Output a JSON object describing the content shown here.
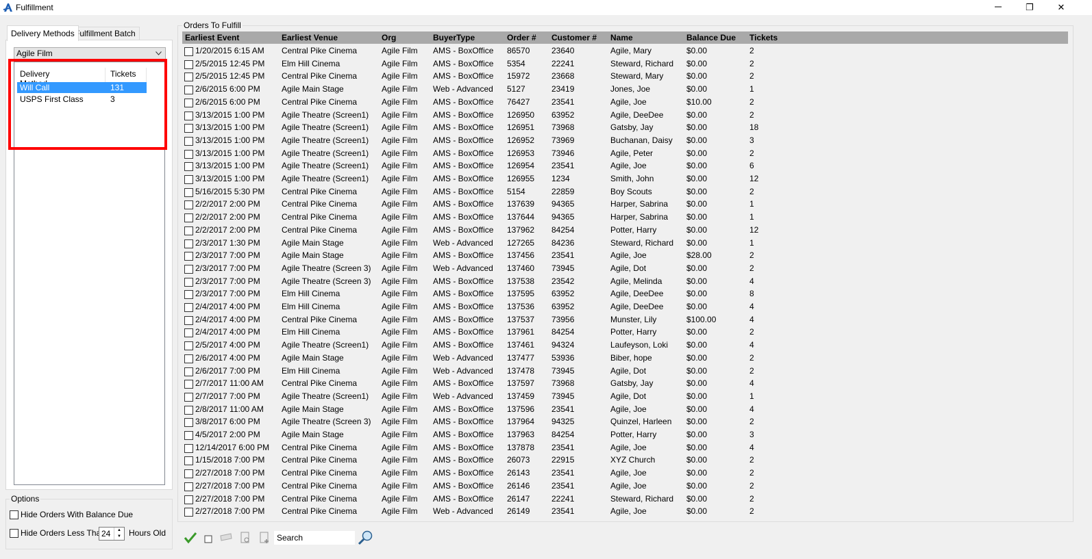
{
  "window": {
    "title": "Fulfillment",
    "restore_glyph": "❐",
    "close_glyph": "✕"
  },
  "tabs": [
    {
      "label": "Delivery Methods"
    },
    {
      "label": "Fulfillment Batch"
    }
  ],
  "org_select": {
    "value": "Agile Film"
  },
  "delivery_list": {
    "columns": {
      "method": "Delivery Method",
      "tickets": "Tickets"
    },
    "rows": [
      {
        "method": "Will Call",
        "tickets": "131"
      },
      {
        "method": "USPS First Class",
        "tickets": "3"
      }
    ]
  },
  "options": {
    "title": "Options",
    "hide_balance_label": "Hide Orders With Balance Due",
    "hide_less_than_label": "Hide Orders Less Than",
    "hours_value": "24",
    "hours_suffix": "Hours Old"
  },
  "orders": {
    "group_title": "Orders To Fulfill",
    "columns": {
      "event": "Earliest Event",
      "venue": "Earliest Venue",
      "org": "Org",
      "buyer": "BuyerType",
      "order": "Order #",
      "customer": "Customer #",
      "name": "Name",
      "balance": "Balance Due",
      "tickets": "Tickets"
    },
    "rows": [
      {
        "event": "1/20/2015 6:15 AM",
        "venue": "Central Pike Cinema",
        "org": "Agile Film",
        "buyer": "AMS - BoxOffice",
        "order": "86570",
        "customer": "23640",
        "name": "Agile, Mary",
        "balance": "$0.00",
        "tickets": "2"
      },
      {
        "event": "2/5/2015 12:45 PM",
        "venue": "Elm Hill Cinema",
        "org": "Agile Film",
        "buyer": "AMS - BoxOffice",
        "order": "5354",
        "customer": "22241",
        "name": "Steward, Richard",
        "balance": "$0.00",
        "tickets": "2"
      },
      {
        "event": "2/5/2015 12:45 PM",
        "venue": "Central Pike Cinema",
        "org": "Agile Film",
        "buyer": "AMS - BoxOffice",
        "order": "15972",
        "customer": "23668",
        "name": "Steward, Mary",
        "balance": "$0.00",
        "tickets": "2"
      },
      {
        "event": "2/6/2015 6:00 PM",
        "venue": "Agile Main Stage",
        "org": "Agile Film",
        "buyer": "Web - Advanced",
        "order": "5127",
        "customer": "23419",
        "name": "Jones, Joe",
        "balance": "$0.00",
        "tickets": "1"
      },
      {
        "event": "2/6/2015 6:00 PM",
        "venue": "Central Pike Cinema",
        "org": "Agile Film",
        "buyer": "AMS - BoxOffice",
        "order": "76427",
        "customer": "23541",
        "name": "Agile, Joe",
        "balance": "$10.00",
        "tickets": "2"
      },
      {
        "event": "3/13/2015 1:00 PM",
        "venue": "Agile Theatre (Screen1)",
        "org": "Agile Film",
        "buyer": "AMS - BoxOffice",
        "order": "126950",
        "customer": "63952",
        "name": "Agile, DeeDee",
        "balance": "$0.00",
        "tickets": "2"
      },
      {
        "event": "3/13/2015 1:00 PM",
        "venue": "Agile Theatre (Screen1)",
        "org": "Agile Film",
        "buyer": "AMS - BoxOffice",
        "order": "126951",
        "customer": "73968",
        "name": "Gatsby, Jay",
        "balance": "$0.00",
        "tickets": "18"
      },
      {
        "event": "3/13/2015 1:00 PM",
        "venue": "Agile Theatre (Screen1)",
        "org": "Agile Film",
        "buyer": "AMS - BoxOffice",
        "order": "126952",
        "customer": "73969",
        "name": "Buchanan, Daisy",
        "balance": "$0.00",
        "tickets": "3"
      },
      {
        "event": "3/13/2015 1:00 PM",
        "venue": "Agile Theatre (Screen1)",
        "org": "Agile Film",
        "buyer": "AMS - BoxOffice",
        "order": "126953",
        "customer": "73946",
        "name": "Agile, Peter",
        "balance": "$0.00",
        "tickets": "2"
      },
      {
        "event": "3/13/2015 1:00 PM",
        "venue": "Agile Theatre (Screen1)",
        "org": "Agile Film",
        "buyer": "AMS - BoxOffice",
        "order": "126954",
        "customer": "23541",
        "name": "Agile, Joe",
        "balance": "$0.00",
        "tickets": "6"
      },
      {
        "event": "3/13/2015 1:00 PM",
        "venue": "Agile Theatre (Screen1)",
        "org": "Agile Film",
        "buyer": "AMS - BoxOffice",
        "order": "126955",
        "customer": "1234",
        "name": "Smith, John",
        "balance": "$0.00",
        "tickets": "12"
      },
      {
        "event": "5/16/2015 5:30 PM",
        "venue": "Central Pike Cinema",
        "org": "Agile Film",
        "buyer": "AMS - BoxOffice",
        "order": "5154",
        "customer": "22859",
        "name": "Boy Scouts",
        "balance": "$0.00",
        "tickets": "2"
      },
      {
        "event": "2/2/2017 2:00 PM",
        "venue": "Central Pike Cinema",
        "org": "Agile Film",
        "buyer": "AMS - BoxOffice",
        "order": "137639",
        "customer": "94365",
        "name": "Harper, Sabrina",
        "balance": "$0.00",
        "tickets": "1"
      },
      {
        "event": "2/2/2017 2:00 PM",
        "venue": "Central Pike Cinema",
        "org": "Agile Film",
        "buyer": "AMS - BoxOffice",
        "order": "137644",
        "customer": "94365",
        "name": "Harper, Sabrina",
        "balance": "$0.00",
        "tickets": "1"
      },
      {
        "event": "2/2/2017 2:00 PM",
        "venue": "Central Pike Cinema",
        "org": "Agile Film",
        "buyer": "AMS - BoxOffice",
        "order": "137962",
        "customer": "84254",
        "name": "Potter, Harry",
        "balance": "$0.00",
        "tickets": "12"
      },
      {
        "event": "2/3/2017 1:30 PM",
        "venue": "Agile Main Stage",
        "org": "Agile Film",
        "buyer": "Web - Advanced",
        "order": "127265",
        "customer": "84236",
        "name": "Steward, Richard",
        "balance": "$0.00",
        "tickets": "1"
      },
      {
        "event": "2/3/2017 7:00 PM",
        "venue": "Agile Main Stage",
        "org": "Agile Film",
        "buyer": "AMS - BoxOffice",
        "order": "137456",
        "customer": "23541",
        "name": "Agile, Joe",
        "balance": "$28.00",
        "tickets": "2"
      },
      {
        "event": "2/3/2017 7:00 PM",
        "venue": "Agile Theatre (Screen 3)",
        "org": "Agile Film",
        "buyer": "Web - Advanced",
        "order": "137460",
        "customer": "73945",
        "name": "Agile, Dot",
        "balance": "$0.00",
        "tickets": "2"
      },
      {
        "event": "2/3/2017 7:00 PM",
        "venue": "Agile Theatre (Screen 3)",
        "org": "Agile Film",
        "buyer": "AMS - BoxOffice",
        "order": "137538",
        "customer": "23542",
        "name": "Agile, Melinda",
        "balance": "$0.00",
        "tickets": "4"
      },
      {
        "event": "2/3/2017 7:00 PM",
        "venue": "Elm Hill Cinema",
        "org": "Agile Film",
        "buyer": "AMS - BoxOffice",
        "order": "137595",
        "customer": "63952",
        "name": "Agile, DeeDee",
        "balance": "$0.00",
        "tickets": "8"
      },
      {
        "event": "2/4/2017 4:00 PM",
        "venue": "Elm Hill Cinema",
        "org": "Agile Film",
        "buyer": "AMS - BoxOffice",
        "order": "137536",
        "customer": "63952",
        "name": "Agile, DeeDee",
        "balance": "$0.00",
        "tickets": "4"
      },
      {
        "event": "2/4/2017 4:00 PM",
        "venue": "Central Pike Cinema",
        "org": "Agile Film",
        "buyer": "AMS - BoxOffice",
        "order": "137537",
        "customer": "73956",
        "name": "Munster, Lily",
        "balance": "$100.00",
        "tickets": "4"
      },
      {
        "event": "2/4/2017 4:00 PM",
        "venue": "Elm Hill Cinema",
        "org": "Agile Film",
        "buyer": "AMS - BoxOffice",
        "order": "137961",
        "customer": "84254",
        "name": "Potter, Harry",
        "balance": "$0.00",
        "tickets": "2"
      },
      {
        "event": "2/5/2017 4:00 PM",
        "venue": "Agile Theatre (Screen1)",
        "org": "Agile Film",
        "buyer": "AMS - BoxOffice",
        "order": "137461",
        "customer": "94324",
        "name": "Laufeyson, Loki",
        "balance": "$0.00",
        "tickets": "4"
      },
      {
        "event": "2/6/2017 4:00 PM",
        "venue": "Agile Main Stage",
        "org": "Agile Film",
        "buyer": "Web - Advanced",
        "order": "137477",
        "customer": "53936",
        "name": "Biber, hope",
        "balance": "$0.00",
        "tickets": "2"
      },
      {
        "event": "2/6/2017 7:00 PM",
        "venue": "Elm Hill Cinema",
        "org": "Agile Film",
        "buyer": "Web - Advanced",
        "order": "137478",
        "customer": "73945",
        "name": "Agile, Dot",
        "balance": "$0.00",
        "tickets": "2"
      },
      {
        "event": "2/7/2017 11:00 AM",
        "venue": "Central Pike Cinema",
        "org": "Agile Film",
        "buyer": "AMS - BoxOffice",
        "order": "137597",
        "customer": "73968",
        "name": "Gatsby, Jay",
        "balance": "$0.00",
        "tickets": "4"
      },
      {
        "event": "2/7/2017 7:00 PM",
        "venue": "Agile Theatre (Screen1)",
        "org": "Agile Film",
        "buyer": "Web - Advanced",
        "order": "137459",
        "customer": "73945",
        "name": "Agile, Dot",
        "balance": "$0.00",
        "tickets": "1"
      },
      {
        "event": "2/8/2017 11:00 AM",
        "venue": "Agile Main Stage",
        "org": "Agile Film",
        "buyer": "AMS - BoxOffice",
        "order": "137596",
        "customer": "23541",
        "name": "Agile, Joe",
        "balance": "$0.00",
        "tickets": "4"
      },
      {
        "event": "3/8/2017 6:00 PM",
        "venue": "Agile Theatre (Screen 3)",
        "org": "Agile Film",
        "buyer": "AMS - BoxOffice",
        "order": "137964",
        "customer": "94325",
        "name": "Quinzel, Harleen",
        "balance": "$0.00",
        "tickets": "2"
      },
      {
        "event": "4/5/2017 2:00 PM",
        "venue": "Agile Main Stage",
        "org": "Agile Film",
        "buyer": "AMS - BoxOffice",
        "order": "137963",
        "customer": "84254",
        "name": "Potter, Harry",
        "balance": "$0.00",
        "tickets": "3"
      },
      {
        "event": "12/14/2017 6:00 PM",
        "venue": "Central Pike Cinema",
        "org": "Agile Film",
        "buyer": "AMS - BoxOffice",
        "order": "137878",
        "customer": "23541",
        "name": "Agile, Joe",
        "balance": "$0.00",
        "tickets": "4"
      },
      {
        "event": "1/15/2018 7:00 PM",
        "venue": "Central Pike Cinema",
        "org": "Agile Film",
        "buyer": "AMS - BoxOffice",
        "order": "26073",
        "customer": "22915",
        "name": "XYZ Church",
        "balance": "$0.00",
        "tickets": "2"
      },
      {
        "event": "2/27/2018 7:00 PM",
        "venue": "Central Pike Cinema",
        "org": "Agile Film",
        "buyer": "AMS - BoxOffice",
        "order": "26143",
        "customer": "23541",
        "name": "Agile, Joe",
        "balance": "$0.00",
        "tickets": "2"
      },
      {
        "event": "2/27/2018 7:00 PM",
        "venue": "Central Pike Cinema",
        "org": "Agile Film",
        "buyer": "AMS - BoxOffice",
        "order": "26146",
        "customer": "23541",
        "name": "Agile, Joe",
        "balance": "$0.00",
        "tickets": "2"
      },
      {
        "event": "2/27/2018 7:00 PM",
        "venue": "Central Pike Cinema",
        "org": "Agile Film",
        "buyer": "AMS - BoxOffice",
        "order": "26147",
        "customer": "22241",
        "name": "Steward, Richard",
        "balance": "$0.00",
        "tickets": "2"
      },
      {
        "event": "2/27/2018 7:00 PM",
        "venue": "Central Pike Cinema",
        "org": "Agile Film",
        "buyer": "Web - Advanced",
        "order": "26149",
        "customer": "23541",
        "name": "Agile, Joe",
        "balance": "$0.00",
        "tickets": "2"
      }
    ]
  },
  "toolbar": {
    "search_placeholder": "Search"
  },
  "colors": {
    "selection": "#3399ff",
    "highlight_border": "#ff0000",
    "grid_header": "#a9a9a9"
  }
}
